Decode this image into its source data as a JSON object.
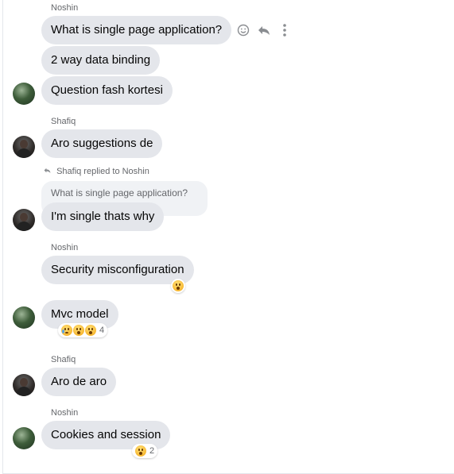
{
  "messages": [
    {
      "sender": "Noshin",
      "text": "What is single page application?"
    },
    {
      "text": "2 way data binding"
    },
    {
      "text": "Question fash kortesi"
    },
    {
      "sender": "Shafiq",
      "text": "Aro suggestions de"
    },
    {
      "reply_label": "Shafiq replied to Noshin",
      "quoted": "What is single page application?",
      "text": "I'm single thats why"
    },
    {
      "sender": "Noshin",
      "text": "Security misconfiguration"
    },
    {
      "text": "Mvc model",
      "reaction_count": "4"
    },
    {
      "sender": "Shafiq",
      "text": "Aro de aro"
    },
    {
      "sender": "Noshin",
      "text": "Cookies and session",
      "reaction_count": "2"
    }
  ],
  "icons": {
    "emoji_button": "smiley-icon",
    "reply_button": "reply-icon",
    "more_button": "more-vertical-icon"
  },
  "colors": {
    "bubble": "#e4e6eb",
    "quoted_bubble": "#f0f2f5",
    "secondary_text": "#65676b"
  }
}
